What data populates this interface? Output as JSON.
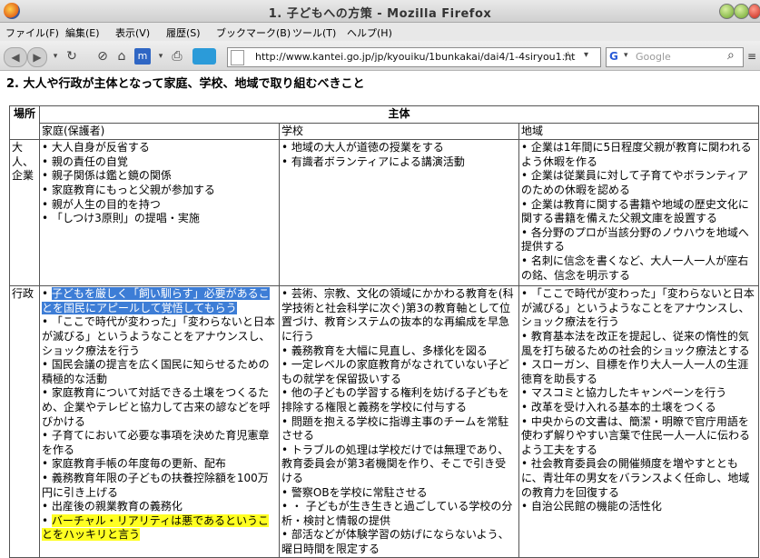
{
  "window": {
    "title": "1. 子どもへの方策 - Mozilla Firefox"
  },
  "menu": [
    "ファイル(F)",
    "編集(E)",
    "表示(V)",
    "履歴(S)",
    "ブックマーク(B)",
    "ツール(T)",
    "ヘルプ(H)"
  ],
  "nav": {
    "url": "http://www.kantei.go.jp/jp/kyouiku/1bunkakai/dai4/1-4siryou1.ht",
    "search_placeholder": "Google",
    "search_engine_letter": "G"
  },
  "page": {
    "heading": "2. 大人や行政が主体となって家庭、学校、地域で取り組むべきこと",
    "table": {
      "col_place": "場所",
      "col_subject": "主体",
      "subcols": [
        "家庭(保護者)",
        "学校",
        "地域"
      ],
      "rows": [
        {
          "label": "大人、企業",
          "home": [
            "大人自身が反省する",
            "親の責任の自覚",
            "親子関係は鑑と鏡の関係",
            "家庭教育にもっと父親が参加する",
            "親が人生の目的を持つ",
            "「しつけ3原則」の提唱・実施"
          ],
          "school": [
            "地域の大人が道徳の授業をする",
            "有識者ボランティアによる講演活動"
          ],
          "community": [
            "企業は1年間に5日程度父親が教育に関われるよう休暇を作る",
            "企業は従業員に対して子育てやボランティアのための休暇を認める",
            "企業は教育に関する書籍や地域の歴史文化に関する書籍を備えた父親文庫を設置する",
            "各分野のプロが当該分野のノウハウを地域へ提供する",
            "名刺に信念を書くなど、大人一人一人が座右の銘、信念を明示する"
          ]
        },
        {
          "label": "行政",
          "home": [
            "子どもを厳しく「飼い馴らす」必要があることを国民にアピールして覚悟してもらう",
            "「ここで時代が変わった」「変わらないと日本が滅びる」というようなことをアナウンスし、ショック療法を行う",
            "国民会議の提言を広く国民に知らせるための積極的な活動",
            "家庭教育について対話できる土壌をつくるため、企業やテレビと協力して古来の諺などを呼びかける",
            "子育てにおいて必要な事項を決めた育児憲章を作る",
            "家庭教育手帳の年度毎の更新、配布",
            "義務教育年限の子どもの扶養控除額を100万円に引き上げる",
            "出産後の親業教育の義務化",
            "バーチャル・リアリティは悪であるということをハッキリと言う"
          ],
          "school": [
            "芸術、宗教、文化の領域にかかわる教育を(科学技術と社会科学に次ぐ)第3の教育軸として位置づけ、教育システムの抜本的な再編成を早急に行う",
            "義務教育を大幅に見直し、多様化を図る",
            "一定レベルの家庭教育がなされていない子どもの就学を保留扱いする",
            "他の子どもの学習する権利を妨げる子どもを排除する権限と義務を学校に付与する",
            "問題を抱える学校に指導主事のチームを常駐させる",
            "トラブルの処理は学校だけでは無理であり、教育委員会が第3者機関を作り、そこで引き受ける",
            "警察OBを学校に常駐させる",
            "・ 子どもが生き生きと過ごしている学校の分析・検討と情報の提供",
            "部活などが体験学習の妨げにならないよう、曜日時間を限定する"
          ],
          "community": [
            "「ここで時代が変わった」「変わらないと日本が滅びる」というようなことをアナウンスし、ショック療法を行う",
            "教育基本法を改正を提起し、従来の惰性的気風を打ち破るための社会的ショック療法とする",
            "スローガン、目標を作り大人一人一人の生涯徳育を助長する",
            "マスコミと協力したキャンペーンを行う",
            "改革を受け入れる基本的土壌をつくる",
            "中央からの文書は、簡潔・明瞭で官庁用語を使わず解りやすい言葉で住民一人一人に伝わるよう工夫をする",
            "社会教育委員会の開催頻度を増やすとともに、青壮年の男女をバランスよく任命し、地域の教育力を回復する",
            "自治公民館の機能の活性化"
          ]
        }
      ]
    }
  },
  "colors": {
    "selection": "#3d7dd6",
    "highlight": "#ffff22"
  }
}
